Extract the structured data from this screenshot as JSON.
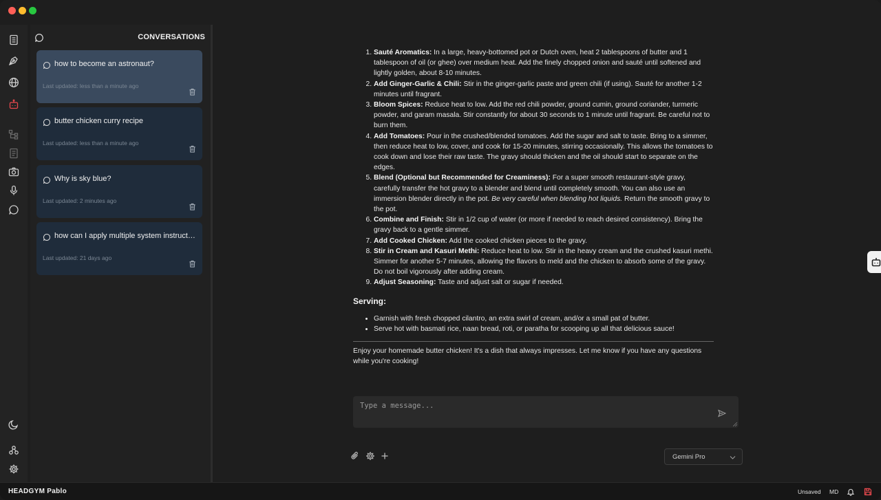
{
  "window": {
    "traffic_lights": {
      "close": "#ff5f57",
      "minimize": "#febc2e",
      "maximize": "#28c840"
    }
  },
  "rail": {
    "icons": [
      "notebook-icon",
      "pen-tool-icon",
      "globe-icon",
      "robot-icon",
      "tree-icon",
      "document-icon",
      "camera-icon",
      "microphone-icon",
      "chat-icon",
      "moon-icon",
      "network-icon",
      "gear-icon"
    ],
    "active_color": "#e5484d"
  },
  "conversations": {
    "title": "CONVERSATIONS",
    "items": [
      {
        "title": "how to become an astronaut?",
        "updated": "Last updated: less than a minute ago"
      },
      {
        "title": "butter chicken curry recipe",
        "updated": "Last updated: less than a minute ago"
      },
      {
        "title": "Why is sky blue?",
        "updated": "Last updated: 2 minutes ago"
      },
      {
        "title": "how can I apply multiple system instructions?",
        "updated": "Last updated: 21 days ago"
      }
    ]
  },
  "message": {
    "steps": [
      {
        "bold": "Sauté Aromatics:",
        "text": " In a large, heavy-bottomed pot or Dutch oven, heat 2 tablespoons of butter and 1 tablespoon of oil (or ghee) over medium heat. Add the finely chopped onion and sauté until softened and lightly golden, about 8-10 minutes."
      },
      {
        "bold": "Add Ginger-Garlic & Chili:",
        "text": " Stir in the ginger-garlic paste and green chili (if using). Sauté for another 1-2 minutes until fragrant."
      },
      {
        "bold": "Bloom Spices:",
        "text": " Reduce heat to low. Add the red chili powder, ground cumin, ground coriander, turmeric powder, and garam masala. Stir constantly for about 30 seconds to 1 minute until fragrant. Be careful not to burn them."
      },
      {
        "bold": "Add Tomatoes:",
        "text": " Pour in the crushed/blended tomatoes. Add the sugar and salt to taste. Bring to a simmer, then reduce heat to low, cover, and cook for 15-20 minutes, stirring occasionally. This allows the tomatoes to cook down and lose their raw taste. The gravy should thicken and the oil should start to separate on the edges."
      },
      {
        "bold": "Blend (Optional but Recommended for Creaminess):",
        "text": " For a super smooth restaurant-style gravy, carefully transfer the hot gravy to a blender and blend until completely smooth. You can also use an immersion blender directly in the pot. ",
        "italic": "Be very careful when blending hot liquids.",
        "text_after": " Return the smooth gravy to the pot."
      },
      {
        "bold": "Combine and Finish:",
        "text": " Stir in 1/2 cup of water (or more if needed to reach desired consistency). Bring the gravy back to a gentle simmer."
      },
      {
        "bold": "Add Cooked Chicken:",
        "text": " Add the cooked chicken pieces to the gravy."
      },
      {
        "bold": "Stir in Cream and Kasuri Methi:",
        "text": " Reduce heat to low. Stir in the heavy cream and the crushed kasuri methi. Simmer for another 5-7 minutes, allowing the flavors to meld and the chicken to absorb some of the gravy. Do not boil vigorously after adding cream."
      },
      {
        "bold": "Adjust Seasoning:",
        "text": " Taste and adjust salt or sugar if needed."
      }
    ],
    "serving_heading": "Serving:",
    "serving": [
      "Garnish with fresh chopped cilantro, an extra swirl of cream, and/or a small pat of butter.",
      "Serve hot with basmati rice, naan bread, roti, or paratha for scooping up all that delicious sauce!"
    ],
    "closing": "Enjoy your homemade butter chicken! It's a dish that always impresses. Let me know if you have any questions while you're cooking!"
  },
  "composer": {
    "placeholder": "Type a message...",
    "model": "Gemini Pro"
  },
  "statusbar": {
    "brand": "HEADGYM Pablo",
    "unsaved": "Unsaved",
    "mode": "MD",
    "save_color": "#e5484d"
  }
}
